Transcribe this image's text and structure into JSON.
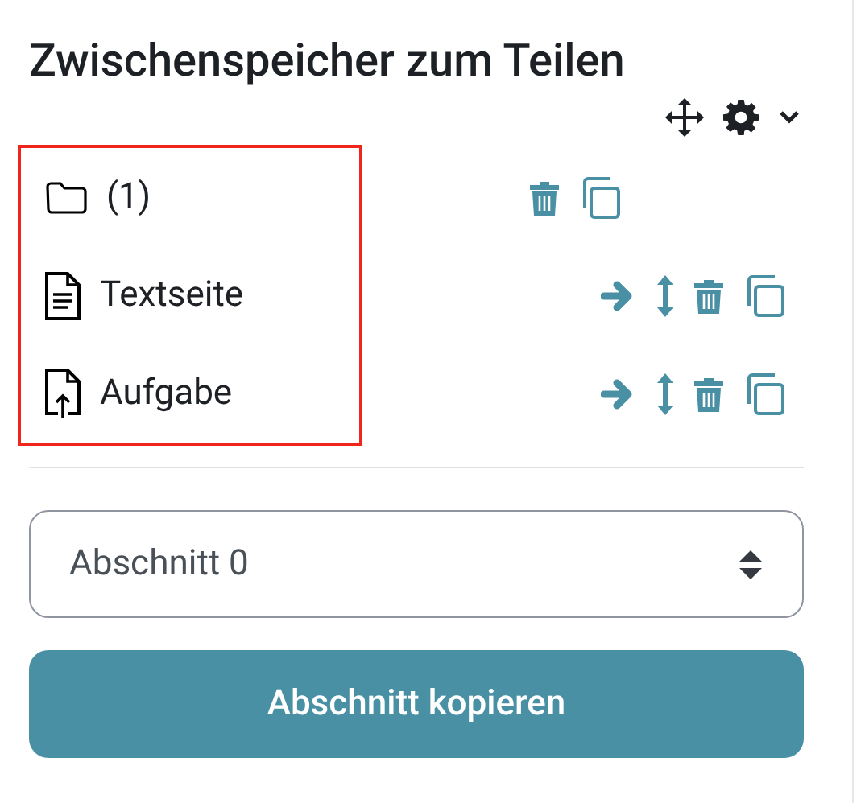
{
  "title": "Zwischenspeicher zum Teilen",
  "items": [
    {
      "kind": "folder",
      "label": "(1)"
    },
    {
      "kind": "page",
      "label": "Textseite"
    },
    {
      "kind": "assignment",
      "label": "Aufgabe"
    }
  ],
  "items_framed": true,
  "section_select": {
    "value": "Abschnitt 0"
  },
  "copy_button": "Abschnitt kopieren"
}
